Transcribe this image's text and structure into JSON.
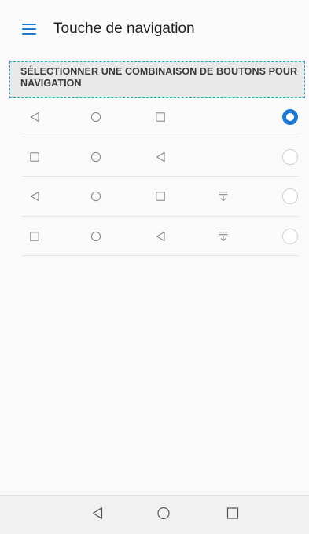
{
  "app_bar": {
    "title": "Touche de navigation",
    "menu_icon": "hamburger-menu-icon",
    "accent_color": "#1e78d2"
  },
  "section": {
    "header_label": "SÉLECTIONNER UNE COMBINAISON DE BOUTONS POUR NAVIGATION"
  },
  "options": [
    {
      "buttons": [
        "back-icon",
        "home-icon",
        "recent-apps-icon"
      ],
      "selected": true
    },
    {
      "buttons": [
        "recent-apps-icon",
        "home-icon",
        "back-icon"
      ],
      "selected": false
    },
    {
      "buttons": [
        "back-icon",
        "home-icon",
        "recent-apps-icon",
        "notification-pull-icon"
      ],
      "selected": false
    },
    {
      "buttons": [
        "recent-apps-icon",
        "home-icon",
        "back-icon",
        "notification-pull-icon"
      ],
      "selected": false
    }
  ],
  "bottom_nav": {
    "buttons": [
      "back-icon",
      "home-icon",
      "recent-apps-icon"
    ]
  }
}
